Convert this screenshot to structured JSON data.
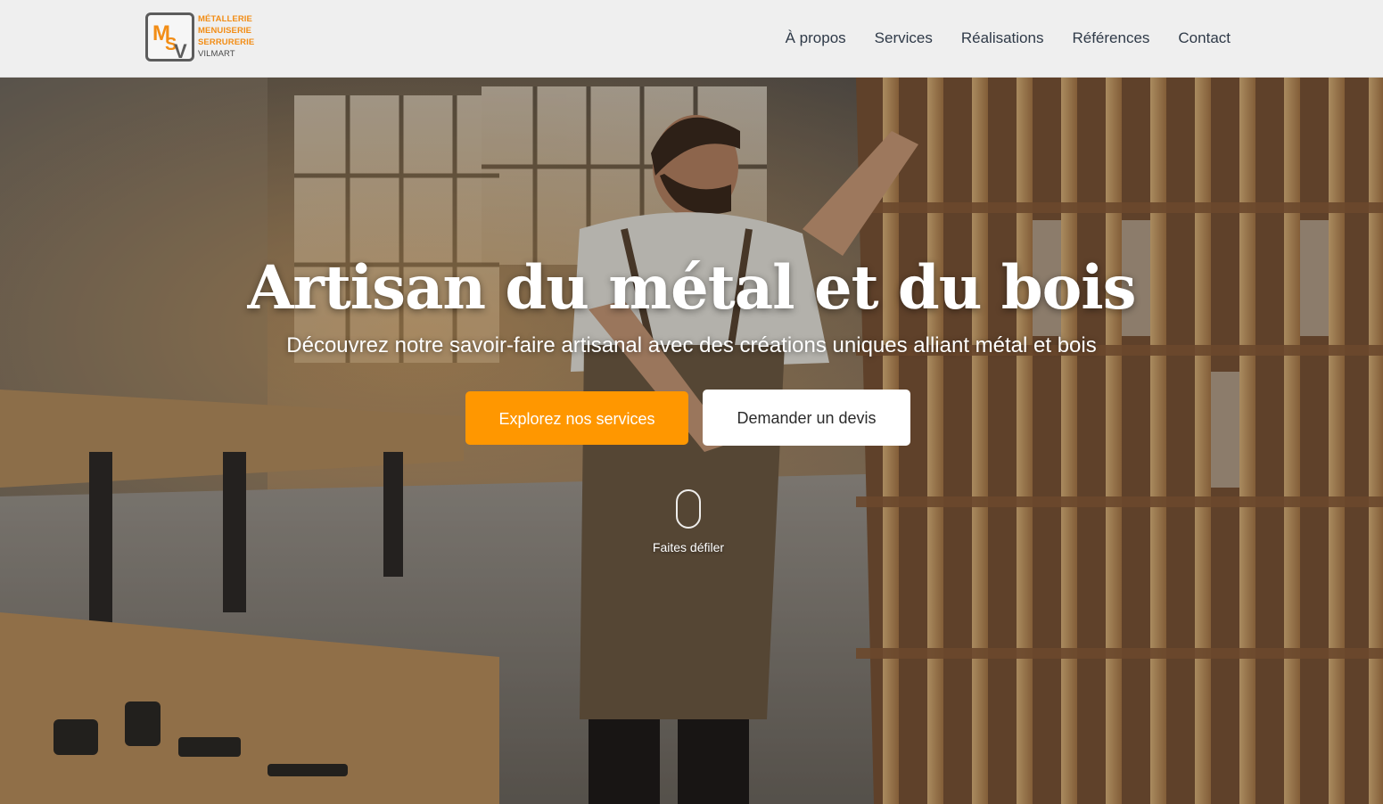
{
  "header": {
    "logo": {
      "monogram": "MSV",
      "lines": [
        "MÉTALLERIE",
        "MENUISERIE",
        "SERRURERIE",
        "VILMART"
      ]
    },
    "nav": [
      {
        "label": "À propos"
      },
      {
        "label": "Services"
      },
      {
        "label": "Réalisations"
      },
      {
        "label": "Références"
      },
      {
        "label": "Contact"
      }
    ]
  },
  "hero": {
    "title": "Artisan du métal et du bois",
    "subtitle": "Découvrez notre savoir-faire artisanal avec des créations uniques alliant métal et bois",
    "primary_button": "Explorez nos services",
    "secondary_button": "Demander un devis",
    "scroll_hint": "Faites défiler"
  },
  "colors": {
    "accent": "#ff9700",
    "logo_orange": "#f28d16",
    "nav_text": "#2f3a48",
    "header_bg": "#efefef"
  }
}
